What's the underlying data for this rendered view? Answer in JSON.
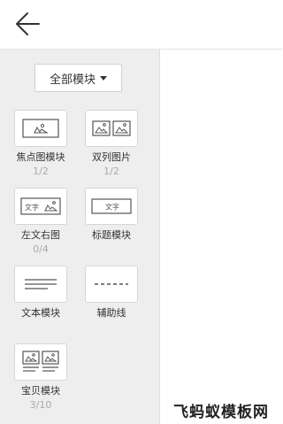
{
  "header": {
    "back_icon": "arrow-left-icon"
  },
  "filter": {
    "label": "全部模块"
  },
  "modules": [
    {
      "label": "焦点图模块",
      "count": "1/2",
      "icon": "focus-image-icon"
    },
    {
      "label": "双列图片",
      "count": "1/2",
      "icon": "double-image-icon"
    },
    {
      "label": "左文右图",
      "count": "0/4",
      "icon": "text-left-image-right-icon",
      "icon_text": "文字"
    },
    {
      "label": "标题模块",
      "icon": "title-icon",
      "icon_text": "文字"
    },
    {
      "label": "文本模块",
      "icon": "text-lines-icon"
    },
    {
      "label": "辅助线",
      "icon": "dashed-line-icon"
    },
    {
      "label": "宝贝模块",
      "count": "3/10",
      "icon": "product-grid-icon"
    }
  ],
  "watermark": "飞蚂蚁模板网"
}
